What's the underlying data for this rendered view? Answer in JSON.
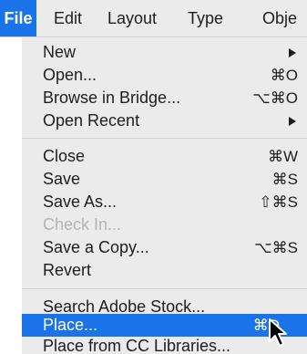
{
  "menubar": {
    "items": [
      {
        "label": "File",
        "active": true
      },
      {
        "label": "Edit"
      },
      {
        "label": "Layout"
      },
      {
        "label": "Type"
      },
      {
        "label": "Obje"
      }
    ]
  },
  "file_menu": {
    "items": [
      {
        "label": "New",
        "submenu": true
      },
      {
        "label": "Open...",
        "shortcut": "⌘O"
      },
      {
        "label": "Browse in Bridge...",
        "shortcut": "⌥⌘O"
      },
      {
        "label": "Open Recent",
        "submenu": true
      },
      {
        "label": "Close",
        "shortcut": "⌘W"
      },
      {
        "label": "Save",
        "shortcut": "⌘S"
      },
      {
        "label": "Save As...",
        "shortcut": "⇧⌘S"
      },
      {
        "label": "Check In...",
        "disabled": true
      },
      {
        "label": "Save a Copy...",
        "shortcut": "⌥⌘S"
      },
      {
        "label": "Revert"
      },
      {
        "label": "Search Adobe Stock..."
      },
      {
        "label": "Place...",
        "shortcut": "⌘D",
        "highlighted": true
      },
      {
        "label": "Place from CC Libraries..."
      }
    ]
  },
  "colors": {
    "highlight": "#1a73e8",
    "menu_bg": "#ebebeb",
    "disabled_text": "#b4b4b4"
  },
  "icons": {
    "cursor": "mouse-pointer-icon",
    "submenu": "triangle-right-icon"
  }
}
